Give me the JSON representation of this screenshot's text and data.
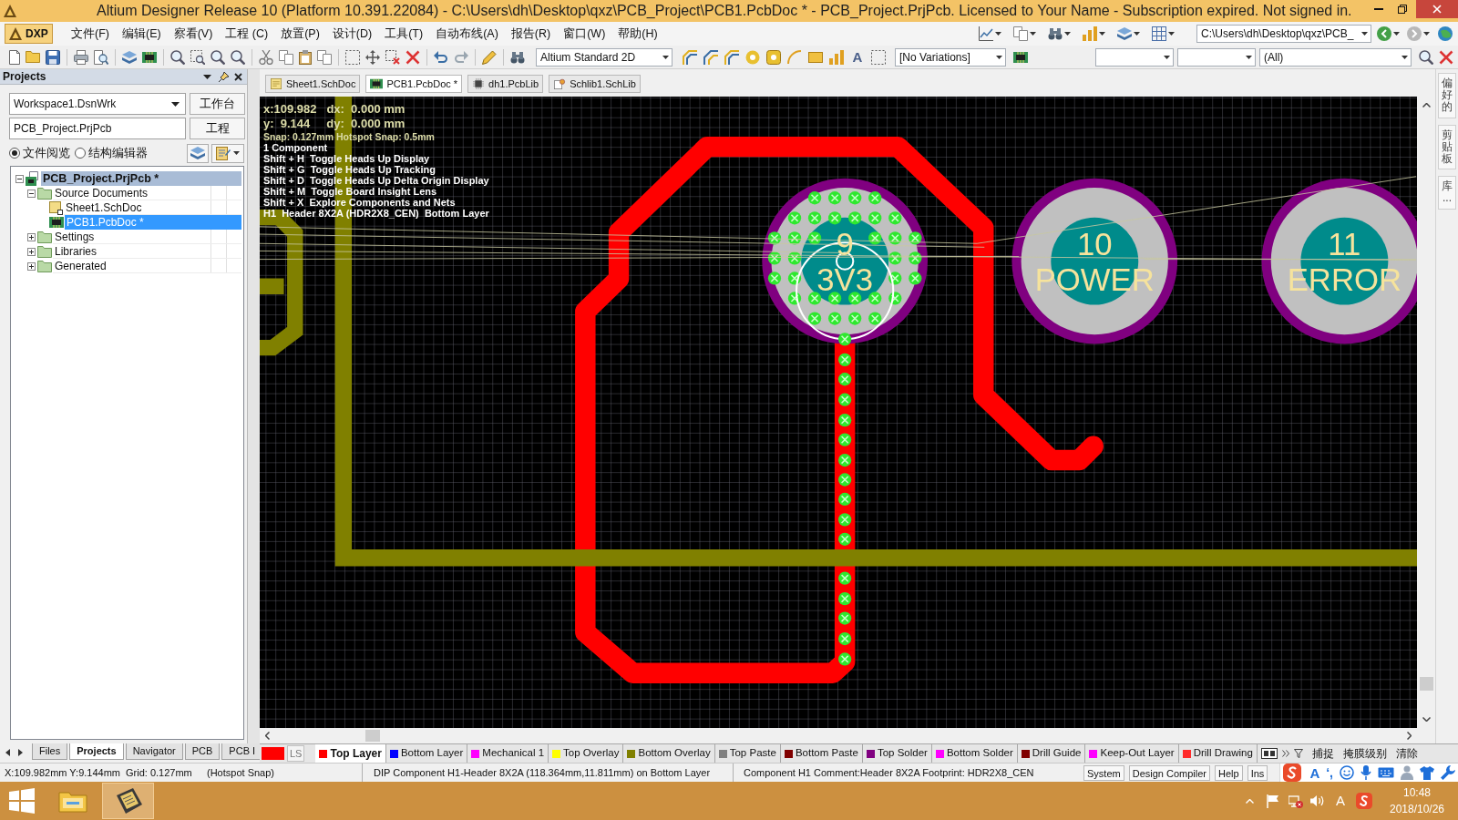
{
  "window": {
    "title": "Altium Designer Release 10 (Platform 10.391.22084) - C:\\Users\\dh\\Desktop\\qxz\\PCB_Project\\PCB1.PcbDoc * - PCB_Project.PrjPcb. Licensed to Your Name - Subscription expired. Not signed in."
  },
  "menu_bar": {
    "dxp": "DXP",
    "items": [
      "文件(F)",
      "编辑(E)",
      "察看(V)",
      "工程 (C)",
      "放置(P)",
      "设计(D)",
      "工具(T)",
      "自动布线(A)",
      "报告(R)",
      "窗口(W)",
      "帮助(H)"
    ],
    "path": "C:\\Users\\dh\\Desktop\\qxz\\PCB_"
  },
  "toolbar": {
    "view": "Altium Standard 2D",
    "text_tool": "A",
    "variations": "[No Variations]",
    "filter": "(All)"
  },
  "projects_panel": {
    "title": "Projects",
    "workspace": "Workspace1.DsnWrk",
    "workspace_button": "工作台",
    "project": "PCB_Project.PrjPcb",
    "project_button": "工程",
    "view_modes": [
      {
        "label": "文件阅览",
        "selected": true
      },
      {
        "label": "结构编辑器",
        "selected": false
      }
    ],
    "tree": {
      "label": "PCB_Project.PrjPcb *",
      "highlighted": true,
      "expanded": true,
      "children": [
        {
          "label": "Source Documents",
          "kind": "folder",
          "expanded": true,
          "selected": false,
          "children": [
            {
              "label": "Sheet1.SchDoc",
              "kind": "schematic",
              "selected": false
            },
            {
              "label": "PCB1.PcbDoc *",
              "kind": "pcb",
              "selected": true
            }
          ]
        },
        {
          "label": "Settings",
          "kind": "folder",
          "expanded": false,
          "selected": false
        },
        {
          "label": "Libraries",
          "kind": "folder",
          "expanded": false,
          "selected": false
        },
        {
          "label": "Generated",
          "kind": "folder",
          "expanded": false,
          "selected": false
        }
      ]
    },
    "tabs": [
      {
        "label": "Files",
        "selected": false
      },
      {
        "label": "Projects",
        "selected": true
      },
      {
        "label": "Navigator",
        "selected": false
      },
      {
        "label": "PCB",
        "selected": false
      },
      {
        "label": "PCB I",
        "selected": false
      }
    ]
  },
  "document_tabs": [
    {
      "label": "Sheet1.SchDoc",
      "kind": "schematic",
      "selected": false
    },
    {
      "label": "PCB1.PcbDoc *",
      "kind": "pcb",
      "selected": true
    },
    {
      "label": "dh1.PcbLib",
      "kind": "pcblib",
      "selected": false
    },
    {
      "label": "Schlib1.SchLib",
      "kind": "schlib",
      "selected": false
    }
  ],
  "canvas": {
    "heads_up": [
      {
        "text": "x:109.982   dx:  0.000 mm",
        "kind": "coordinate"
      },
      {
        "text": "y:  9.144     dy:  0.000 mm",
        "kind": "coordinate"
      },
      {
        "text": "Snap: 0.127mm Hotspot Snap: 0.5mm",
        "kind": "snap"
      },
      {
        "text": "1 Component",
        "kind": "info"
      },
      {
        "text": "Shift + H  Toggle Heads Up Display",
        "kind": "info"
      },
      {
        "text": "Shift + G  Toggle Heads Up Tracking",
        "kind": "info"
      },
      {
        "text": "Shift + D  Toggle Heads Up Delta Origin Display",
        "kind": "info"
      },
      {
        "text": "Shift + M  Toggle Board Insight Lens",
        "kind": "info"
      },
      {
        "text": "Shift + X  Explore Components and Nets",
        "kind": "info"
      },
      {
        "text": "H1  Header 8X2A (HDR2X8_CEN)  Bottom Layer",
        "kind": "info"
      }
    ],
    "pads": [
      {
        "number": "9",
        "net": "3V3",
        "selected": true
      },
      {
        "number": "10",
        "net": "POWER",
        "selected": false
      },
      {
        "number": "11",
        "net": "ERROR",
        "selected": false
      }
    ]
  },
  "side_panels": [
    "偏好的",
    "剪贴板",
    "库..."
  ],
  "layer_bar": {
    "layer_sets": "LS",
    "layers": [
      {
        "label": "Top Layer",
        "color": "#ff0000",
        "selected": true
      },
      {
        "label": "Bottom Layer",
        "color": "#0000ff",
        "selected": false
      },
      {
        "label": "Mechanical 1",
        "color": "#ff00ff",
        "selected": false
      },
      {
        "label": "Top Overlay",
        "color": "#ffff00",
        "selected": false
      },
      {
        "label": "Bottom Overlay",
        "color": "#808000",
        "selected": false
      },
      {
        "label": "Top Paste",
        "color": "#808080",
        "selected": false
      },
      {
        "label": "Bottom Paste",
        "color": "#800000",
        "selected": false
      },
      {
        "label": "Top Solder",
        "color": "#800080",
        "selected": false
      },
      {
        "label": "Bottom Solder",
        "color": "#ff00ff",
        "selected": false
      },
      {
        "label": "Drill Guide",
        "color": "#800000",
        "selected": false
      },
      {
        "label": "Keep-Out Layer",
        "color": "#ff00ff",
        "selected": false
      },
      {
        "label": "Drill Drawing",
        "color": "#ff2a2a",
        "selected": false
      }
    ],
    "buttons": [
      "捕捉",
      "掩膜级别",
      "清除"
    ]
  },
  "status_bar": {
    "fields": [
      "X:109.982mm Y:9.144mm",
      "Grid: 0.127mm",
      "(Hotspot Snap)",
      "DIP Component H1-Header 8X2A (118.364mm,11.811mm) on Bottom Layer",
      "Component H1 Comment:Header 8X2A Footprint: HDR2X8_CEN"
    ],
    "buttons": [
      "System",
      "Design Compiler",
      "Help",
      "Ins"
    ]
  },
  "ime_bar": {
    "mode": "A",
    "punctuation": "‘,"
  },
  "taskbar": {
    "input_language": "A",
    "time": "10:48",
    "date": "2018/10/26"
  }
}
